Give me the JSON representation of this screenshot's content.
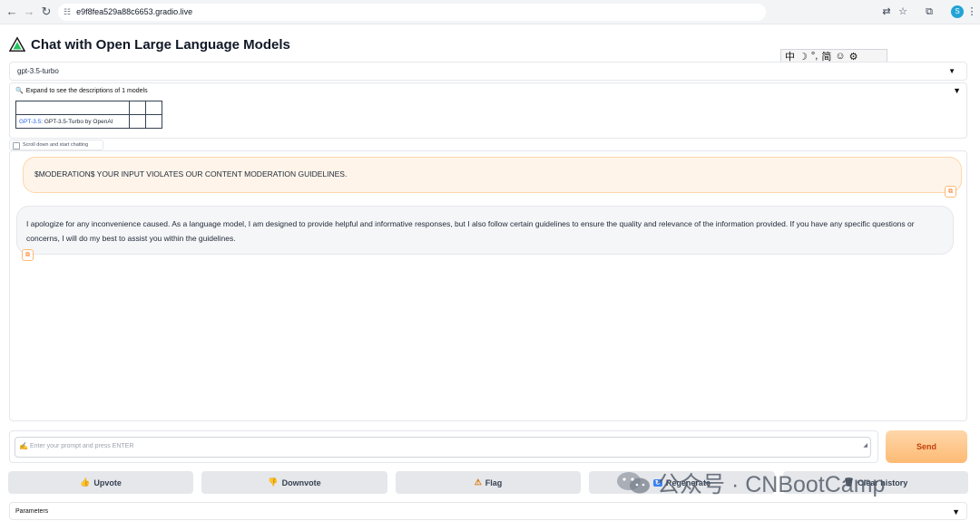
{
  "browser": {
    "url": "e9f8fea529a88c6653.gradio.live",
    "profile_initial": "S"
  },
  "header": {
    "title": "Chat with Open Large Language Models"
  },
  "ime": {
    "items": [
      "中",
      "☽",
      "°,",
      "简",
      "☺",
      "⚙"
    ]
  },
  "model_select": {
    "value": "gpt-3.5-turbo"
  },
  "accordion": {
    "label": "Expand to see the descriptions of 1 models",
    "model_link": "GPT-3.5",
    "model_desc": ": GPT-3.5-Turbo by OpenAI"
  },
  "scroll_hint": "Scroll down and start chatting",
  "chat": {
    "user_message": "$MODERATION$ YOUR INPUT VIOLATES OUR CONTENT MODERATION GUIDELINES.",
    "bot_message": "I apologize for any inconvenience caused. As a language model, I am designed to provide helpful and informative responses, but I also follow certain guidelines to ensure the quality and relevance of the information provided. If you have any specific questions or concerns, I will do my best to assist you within the guidelines."
  },
  "input": {
    "placeholder": "Enter your prompt and press ENTER",
    "send_label": "Send"
  },
  "actions": {
    "upvote": "Upvote",
    "downvote": "Downvote",
    "flag": "Flag",
    "regenerate": "Regenerate",
    "clear": "Clear history"
  },
  "parameters_label": "Parameters",
  "watermark": {
    "text": "公众号 · CNBootCamp"
  },
  "colors": {
    "user_bubble": "#fff4ea",
    "bot_bubble": "#f5f6f8",
    "send_button": "#fdba74",
    "link": "#2563eb"
  }
}
